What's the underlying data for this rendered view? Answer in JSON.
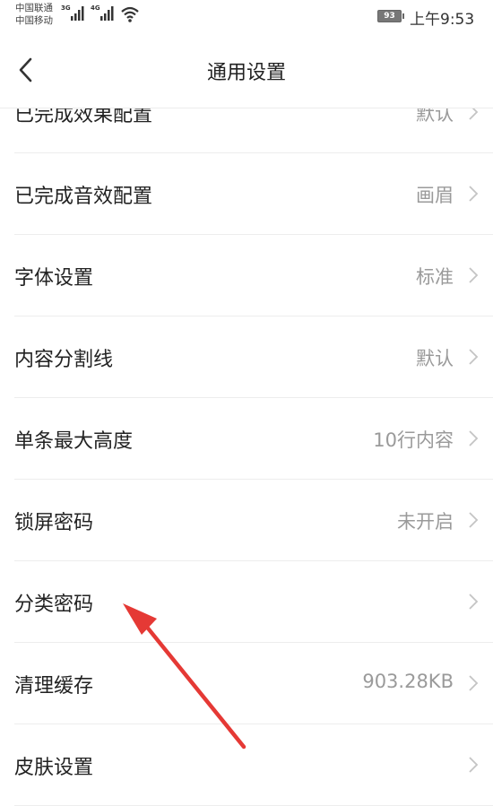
{
  "status_bar": {
    "carrier_1": "中国联通",
    "carrier_2": "中国移动",
    "net_1": "3G",
    "net_2": "4G",
    "battery": "93",
    "time": "上午9:53"
  },
  "header": {
    "title": "通用设置",
    "back_icon": "chevron-left-icon"
  },
  "settings": [
    {
      "label": "已完成效果配置",
      "value": "默认"
    },
    {
      "label": "已完成音效配置",
      "value": "画眉"
    },
    {
      "label": "字体设置",
      "value": "标准"
    },
    {
      "label": "内容分割线",
      "value": "默认"
    },
    {
      "label": "单条最大高度",
      "value": "10行内容"
    },
    {
      "label": "锁屏密码",
      "value": "未开启"
    },
    {
      "label": "分类密码",
      "value": ""
    },
    {
      "label": "清理缓存",
      "value": "903.28KB"
    },
    {
      "label": "皮肤设置",
      "value": ""
    }
  ],
  "annotation": {
    "color": "#e53935",
    "icon": "red-arrow-annotation"
  }
}
